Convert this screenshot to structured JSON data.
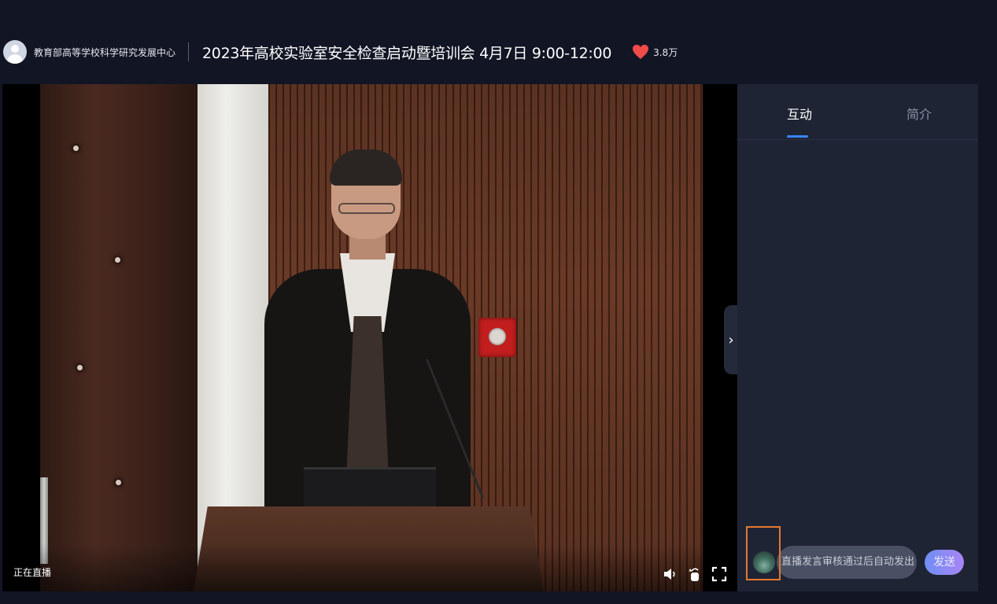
{
  "header": {
    "org_name": "教育部高等学校科学研究发展中心",
    "event_title": "2023年高校实验室安全检查启动暨培训会 4月7日 9:00-12:00",
    "like_count": "3.8万",
    "like_icon": "heart-icon",
    "like_color": "#f04a4a"
  },
  "video": {
    "status_label": "正在直播",
    "controls": [
      "volume-icon",
      "rotate-icon",
      "fullscreen-icon"
    ]
  },
  "sidebar": {
    "tabs": [
      {
        "label": "互动",
        "active": true
      },
      {
        "label": "简介",
        "active": false
      }
    ],
    "chat": {
      "placeholder": "直播发言审核通过后自动发出",
      "send_label": "发送"
    }
  },
  "colors": {
    "background": "#111524",
    "sidebar": "#1f2435",
    "accent": "#3a86ff",
    "send_gradient_start": "#6f8ff6",
    "send_gradient_end": "#a884f3",
    "highlight": "#e5782f"
  }
}
